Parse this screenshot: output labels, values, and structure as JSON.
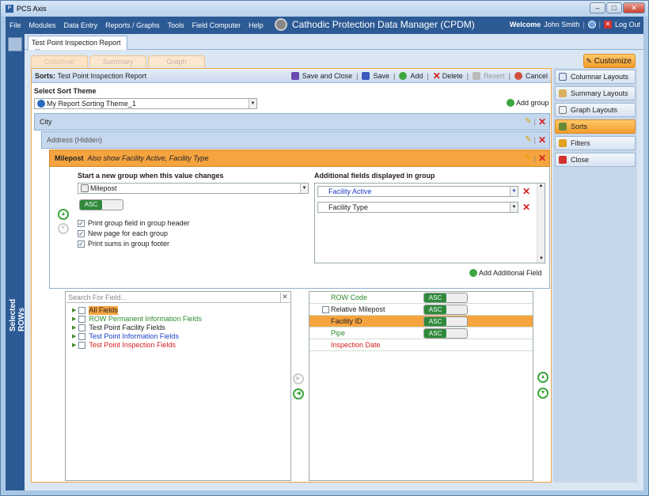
{
  "window": {
    "title": "PCS Axis",
    "app_icon": "P",
    "minimize": "–",
    "maximize": "□",
    "close": "✕"
  },
  "menu": {
    "items": [
      "File",
      "Modules",
      "Data Entry",
      "Reports / Graphs",
      "Tools",
      "Field Computer",
      "Help"
    ],
    "app_title": "Cathodic Protection Data Manager (CPDM)",
    "welcome_label": "Welcome",
    "user": "John Smith",
    "logout": "Log Out"
  },
  "doc_tab": {
    "label": "Test Point Inspection Report",
    "close": "✕"
  },
  "left_bar": {
    "label": "Selected ROWs"
  },
  "view_tabs": [
    "Columnar",
    "Summary",
    "Graph"
  ],
  "customize_label": "Customize",
  "sorts_panel": {
    "title_label": "Sorts:",
    "title_value": "Test Point Inspection Report",
    "toolbar": {
      "save_close": "Save and Close",
      "save": "Save",
      "add": "Add",
      "delete": "Delete",
      "revert": "Revert",
      "cancel": "Cancel"
    },
    "select_theme_label": "Select Sort Theme",
    "theme_value": "My Report Sorting Theme_1",
    "add_group": "Add group",
    "groups": [
      {
        "name": "City"
      },
      {
        "name": "Address (Hidden)"
      },
      {
        "name": "Milepost",
        "extra": "Also show Facility Active, Facility Type"
      }
    ],
    "group_detail": {
      "start_group_label": "Start a new group when this value changes",
      "field_value": "Milepost",
      "asc": "ASC",
      "checkboxes": [
        "Print group field in group header",
        "New page for each group",
        "Print sums in group footer"
      ],
      "additional_label": "Additional fields displayed in group",
      "additional_fields": [
        "Facility Active",
        "Facility Type"
      ],
      "add_additional": "Add Additional Field"
    },
    "field_search_placeholder": "Search For Field...",
    "field_tree": [
      {
        "label": "All Fields",
        "color": "#000000"
      },
      {
        "label": "ROW Permanent Information Fields",
        "color": "#2e8a2e"
      },
      {
        "label": "Test Point Facility Fields",
        "color": "#000000"
      },
      {
        "label": "Test Point Information Fields",
        "color": "#1a3fc4"
      },
      {
        "label": "Test Point Inspection Fields",
        "color": "#d42020"
      }
    ],
    "sort_fields": [
      {
        "label": "ROW Code",
        "color": "#2e8a2e",
        "asc": "ASC"
      },
      {
        "label": "Relative Milepost",
        "color": "#000000",
        "asc": "ASC"
      },
      {
        "label": "Facility ID",
        "color": "#000000",
        "asc": "ASC"
      },
      {
        "label": "Pipe",
        "color": "#2e8a2e",
        "asc": "ASC"
      },
      {
        "label": "Inspection Date",
        "color": "#d42020",
        "asc": ""
      }
    ]
  },
  "right_panel": {
    "items": [
      "Columnar Layouts",
      "Summary Layouts",
      "Graph Layouts",
      "Sorts",
      "Filters",
      "Close"
    ]
  },
  "colors": {
    "accent": "#f39c2c",
    "menubar": "#2c5a95",
    "group_header": "#c5d8ee",
    "green": "#2e8a3a",
    "red": "#d42020"
  }
}
